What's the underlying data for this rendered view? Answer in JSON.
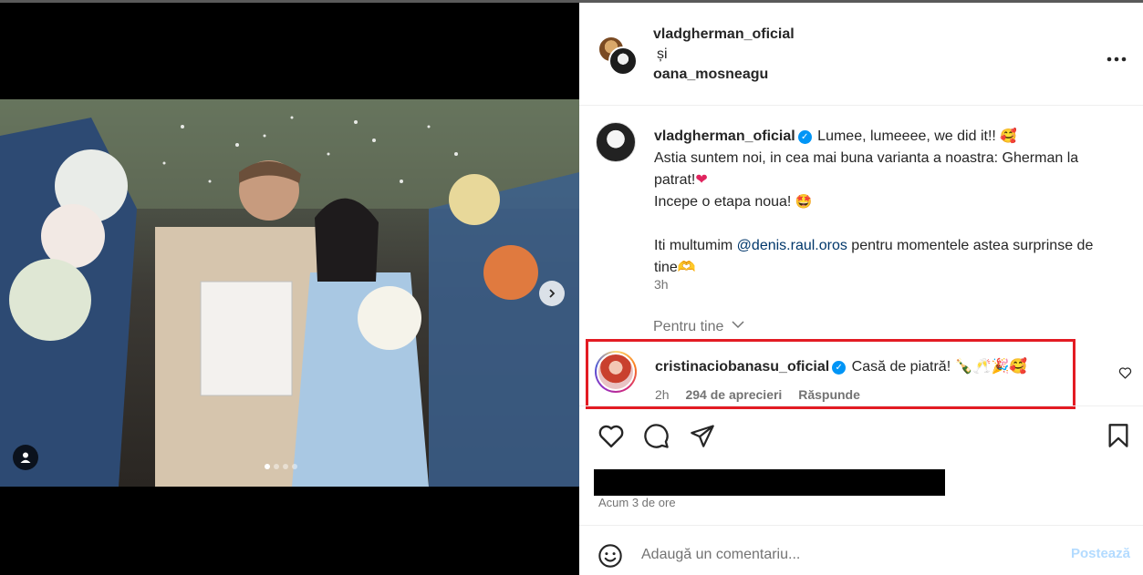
{
  "colors": {
    "verified": "#0095f6",
    "highlight_border": "#e31b23",
    "muted_text": "#737373",
    "post_disabled": "#b3dbff",
    "mention": "#00376b"
  },
  "post_header": {
    "user1": "vladgherman_oficial",
    "conjunction": "și",
    "user2": "oana_mosneagu",
    "more_icon": "more-horizontal-icon"
  },
  "caption": {
    "username": "vladgherman_oficial",
    "line1": "Lumee, lumeeee, we did it!!",
    "emoji1": "🥰",
    "line2": "Astia suntem noi, in cea mai buna varianta a noastra: Gherman la patrat!",
    "emoji2": "❤",
    "line3": "Incepe o etapa noua!",
    "emoji3": "🤩",
    "line4_prefix": "Iti multumim ",
    "mention": "@denis.raul.oros",
    "line4_suffix": " pentru momentele astea surprinse de tine",
    "line4_end": "🫶",
    "time": "3h"
  },
  "for_you": "Pentru tine",
  "comment": {
    "username": "cristinaciobanasu_oficial",
    "text": "Casă de piatră!",
    "emojis": "🍾🥂🎉🥰",
    "time": "2h",
    "likes": "294 de aprecieri",
    "reply": "Răspunde"
  },
  "actions": {
    "like_icon": "heart-icon",
    "comment_icon": "comment-icon",
    "share_icon": "send-icon",
    "save_icon": "bookmark-icon",
    "time_ago": "Acum 3 de ore"
  },
  "add_comment": {
    "placeholder": "Adaugă un comentariu...",
    "post_label": "Postează"
  },
  "carousel": {
    "slide_count": 4,
    "active_index": 0
  }
}
